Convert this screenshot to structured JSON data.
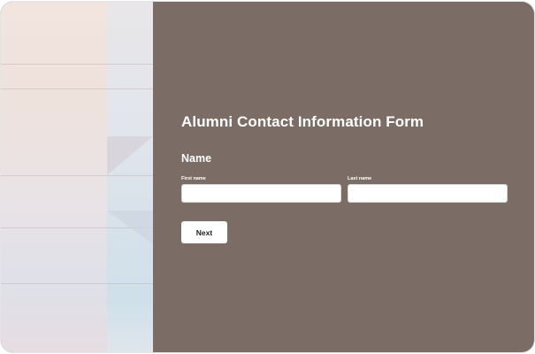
{
  "form": {
    "title": "Alumni Contact Information Form",
    "section_name": "Name",
    "fields": {
      "first_name": {
        "label": "First name",
        "value": "",
        "placeholder": ""
      },
      "last_name": {
        "label": "Last name",
        "value": "",
        "placeholder": ""
      }
    },
    "next_label": "Next"
  },
  "colors": {
    "panel_background": "#7b6c66",
    "text": "#ffffff",
    "input_background": "#ffffff",
    "button_background": "#ffffff",
    "button_text": "#1d1d1d"
  }
}
